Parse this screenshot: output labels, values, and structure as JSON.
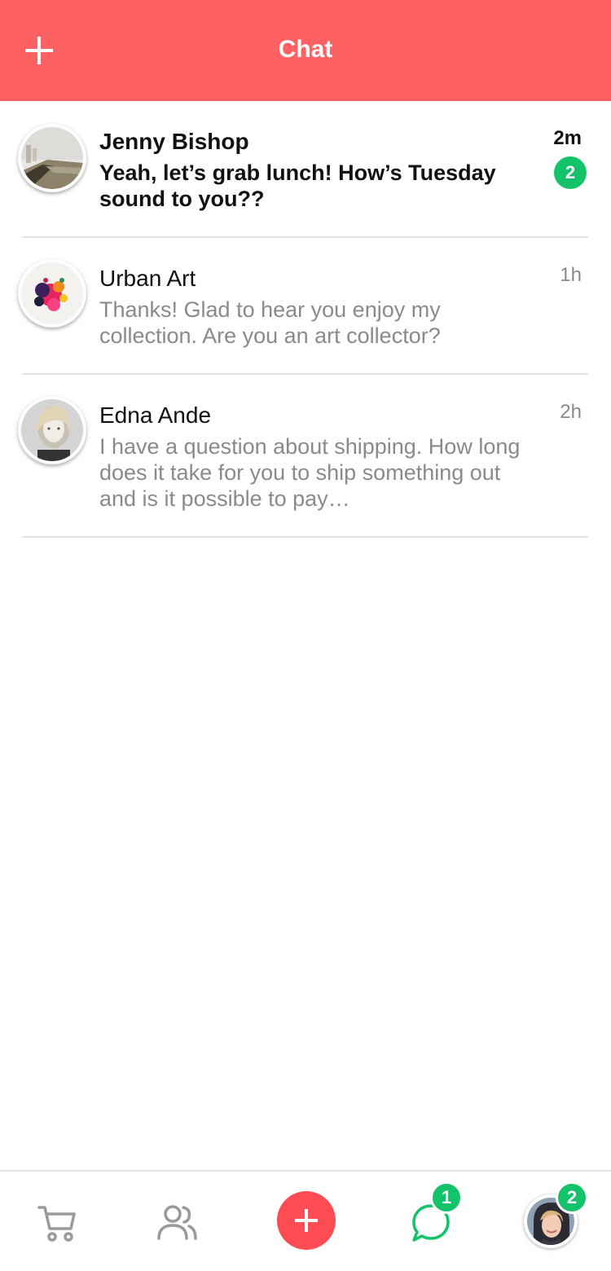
{
  "header": {
    "title": "Chat",
    "add_icon": "plus-icon",
    "background_color": "#fe6162"
  },
  "chats": [
    {
      "name": "Jenny Bishop",
      "preview": "Yeah, let’s grab lunch! How’s Tuesday sound to you??",
      "time": "2m",
      "unread_count": "2",
      "unread": true,
      "avatar": "beach-photo"
    },
    {
      "name": "Urban Art",
      "preview": "Thanks! Glad to hear you enjoy my collection. Are you an art collector?",
      "time": "1h",
      "unread": false,
      "avatar": "paint-splash-art"
    },
    {
      "name": "Edna Ande",
      "preview": "I have a question about shipping. How long does it take for you to ship something out and is it possible to pay…",
      "time": "2h",
      "unread": false,
      "avatar": "woman-portrait-bw"
    }
  ],
  "tabbar": {
    "tabs": [
      "cart-icon",
      "people-icon",
      "add-icon",
      "chat-bubble-icon",
      "profile-avatar"
    ],
    "chat_badge": "1",
    "profile_badge": "2",
    "accent_color": "#fe4c55",
    "badge_color": "#14c26a"
  }
}
